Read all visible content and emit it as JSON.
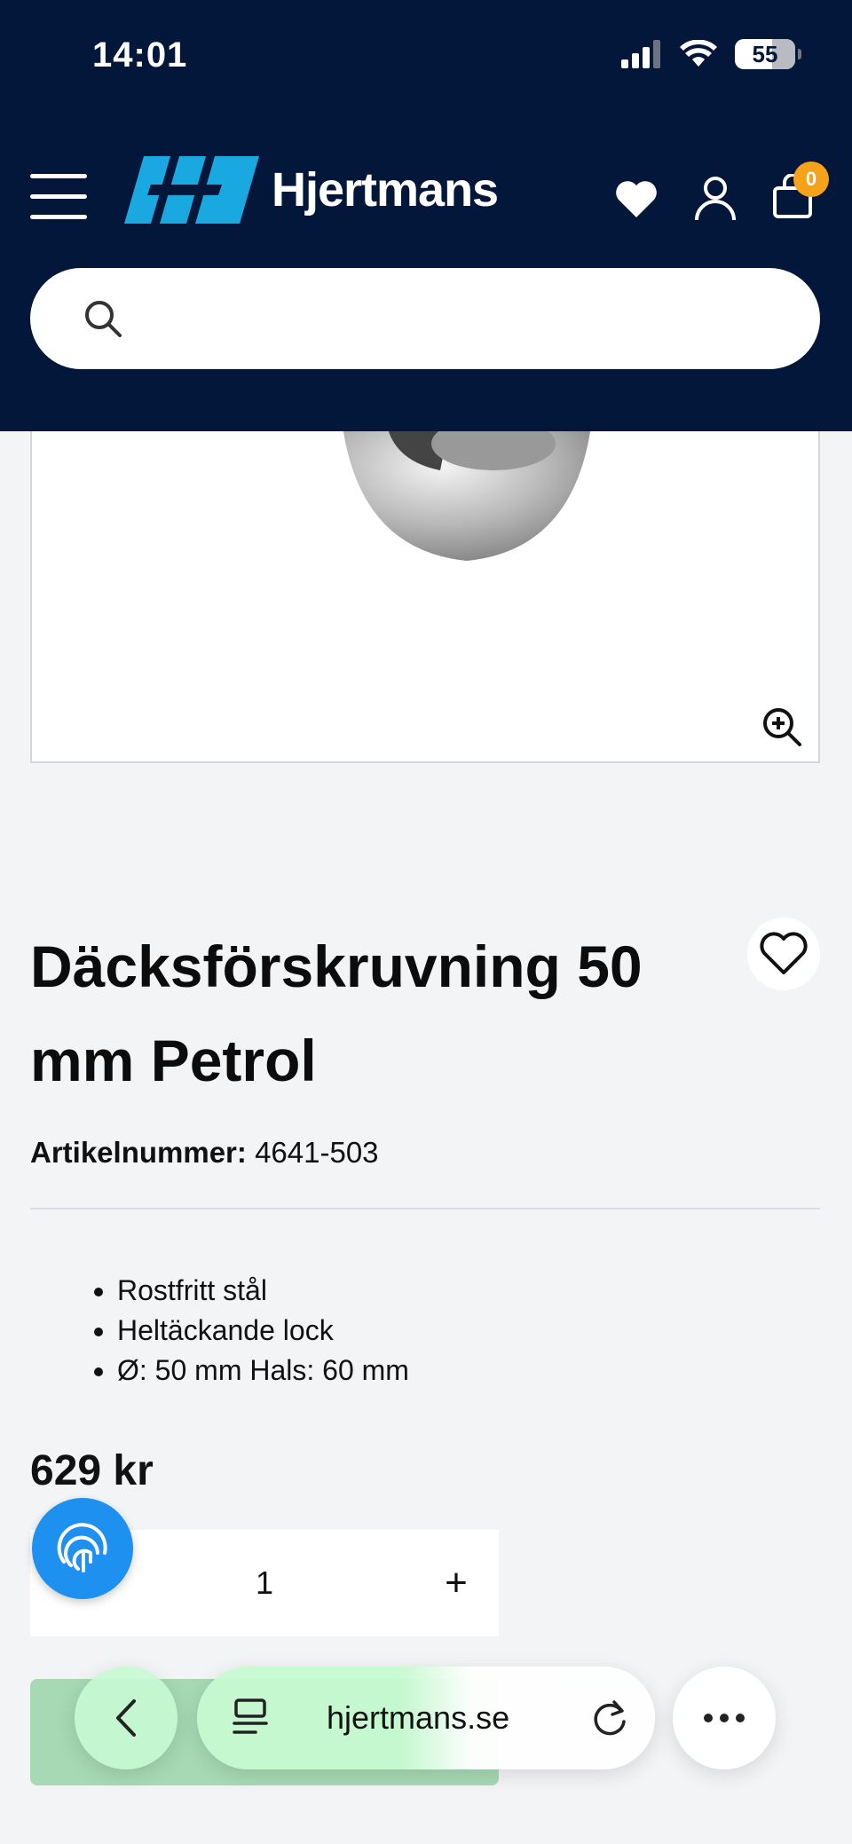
{
  "status_bar": {
    "time": "14:01",
    "battery": "55"
  },
  "header": {
    "logo_text": "Hjertmans",
    "cart_count": "0",
    "search_placeholder": ""
  },
  "product": {
    "title": "Däcksförskruvning 50 mm Petrol",
    "sku_label": "Artikelnummer:",
    "sku_value": "4641-503",
    "features": [
      "Rostfritt stål",
      "Heltäckande lock",
      "Ø: 50 mm Hals: 60 mm"
    ],
    "price": "629 kr",
    "quantity": "1",
    "plus_label": "+"
  },
  "browser": {
    "url": "hjertmans.se"
  },
  "colors": {
    "header_bg": "#03173a",
    "accent_badge": "#f7a21b",
    "chat_bubble": "#1e90f0"
  }
}
